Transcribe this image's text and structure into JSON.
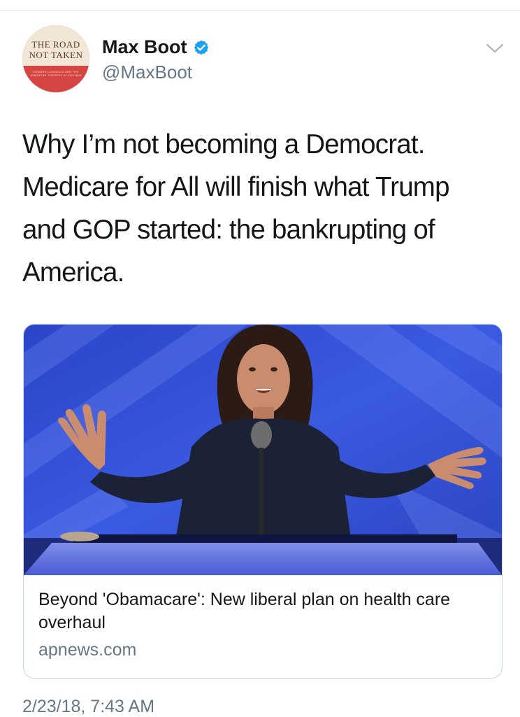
{
  "tweet": {
    "avatar": {
      "line1": "THE ROAD",
      "line2": "NOT TAKEN",
      "subtitle": "EDWARD LANSDALE AND THE AMERICAN TRAGEDY IN VIETNAM"
    },
    "author_name": "Max Boot",
    "verified": true,
    "handle": "@MaxBoot",
    "text": "Why I’m not becoming a Democrat.\nMedicare for All will finish what Trump\nand GOP started: the bankrupting of\nAmerica.",
    "card": {
      "title": "Beyond 'Obamacare': New liberal plan on health care overhaul",
      "domain": "apnews.com"
    },
    "timestamp": "2/23/18, 7:43 AM"
  },
  "icons": {
    "verified": "verified-badge-icon",
    "menu": "chevron-down-icon"
  },
  "colors": {
    "verified_blue": "#1da1f2",
    "secondary_text": "#657786",
    "border": "#ccd6dd",
    "stage_blue": "#2f4fd6"
  }
}
